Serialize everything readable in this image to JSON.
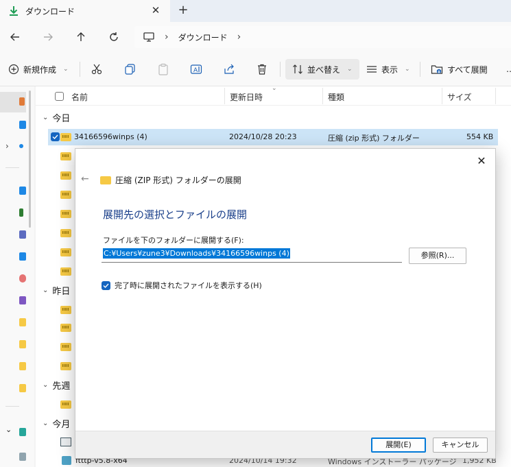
{
  "tab": {
    "title": "ダウンロード",
    "close": "✕",
    "new": "+"
  },
  "nav": {
    "breadcrumb": "ダウンロード"
  },
  "toolbar": {
    "new_label": "新規作成",
    "sort_label": "並べ替え",
    "view_label": "表示",
    "extract_all_label": "すべて展開",
    "more": "…"
  },
  "columns": {
    "name": "名前",
    "modified": "更新日時",
    "type": "種類",
    "size": "サイズ"
  },
  "groups": {
    "today": "今日",
    "yesterday": "昨日",
    "last_week": "先週",
    "this_month": "今月"
  },
  "rows": [
    {
      "name": "34166596winps (4)",
      "modified": "2024/10/28 20:23",
      "type": "圧縮 (zip 形式) フォルダー",
      "size": "554 KB"
    }
  ],
  "bottom_row": {
    "name": "ftttp-v5.8-x64",
    "modified": "2024/10/14 19:32",
    "type": "Windows インストーラー パッケージ",
    "size": "1,952 KB"
  },
  "dialog": {
    "close": "✕",
    "back": "←",
    "title": "圧縮 (ZIP 形式) フォルダーの展開",
    "heading": "展開先の選択とファイルの展開",
    "dest_label": "ファイルを下のフォルダーに展開する(F):",
    "dest_value": "C:¥Users¥zune3¥Downloads¥34166596winps (4)",
    "browse": "参照(R)...",
    "show_files_label": "完了時に展開されたファイルを表示する(H)",
    "show_files_checked": true,
    "extract_button": "展開(E)",
    "cancel_button": "キャンセル"
  }
}
